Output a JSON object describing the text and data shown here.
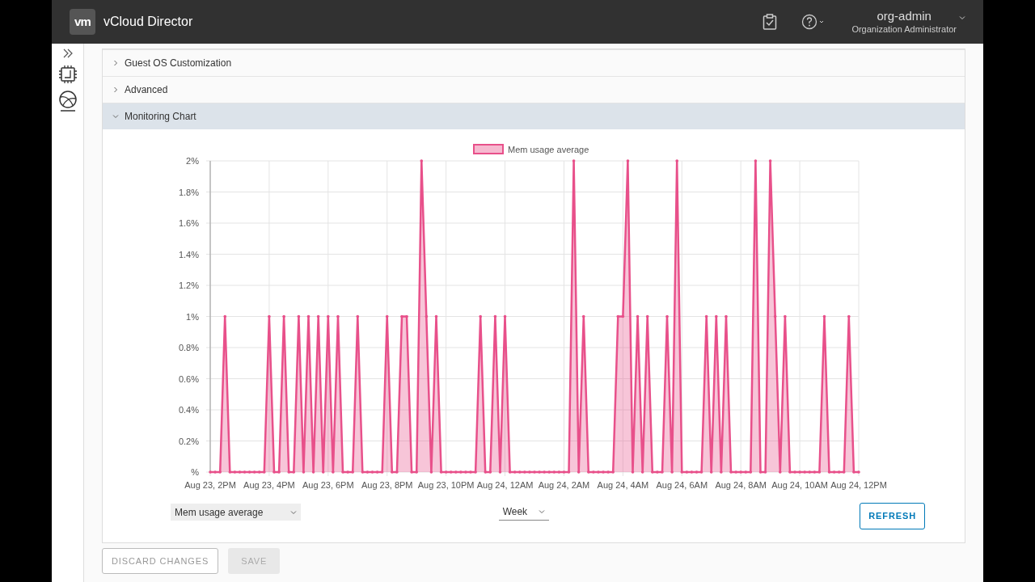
{
  "header": {
    "logo": "vm",
    "title": "vCloud Director",
    "user": "org-admin",
    "role": "Organization Administrator"
  },
  "sections": [
    {
      "label": "Guest OS Customization",
      "expanded": false
    },
    {
      "label": "Advanced",
      "expanded": false
    },
    {
      "label": "Monitoring Chart",
      "expanded": true
    }
  ],
  "monitoring": {
    "chart_data": {
      "type": "area",
      "categories": [
        "Aug 23, 2PM",
        null,
        null,
        null,
        null,
        null,
        null,
        null,
        null,
        null,
        null,
        null,
        "Aug 23, 4PM",
        null,
        null,
        null,
        null,
        null,
        null,
        null,
        null,
        null,
        null,
        null,
        "Aug 23, 6PM",
        null,
        null,
        null,
        null,
        null,
        null,
        null,
        null,
        null,
        null,
        null,
        "Aug 23, 8PM",
        null,
        null,
        null,
        null,
        null,
        null,
        null,
        null,
        null,
        null,
        null,
        "Aug 23, 10PM",
        null,
        null,
        null,
        null,
        null,
        null,
        null,
        null,
        null,
        null,
        null,
        "Aug 24, 12AM",
        null,
        null,
        null,
        null,
        null,
        null,
        null,
        null,
        null,
        null,
        null,
        "Aug 24, 2AM",
        null,
        null,
        null,
        null,
        null,
        null,
        null,
        null,
        null,
        null,
        null,
        "Aug 24, 4AM",
        null,
        null,
        null,
        null,
        null,
        null,
        null,
        null,
        null,
        null,
        null,
        "Aug 24, 6AM",
        null,
        null,
        null,
        null,
        null,
        null,
        null,
        null,
        null,
        null,
        null,
        "Aug 24, 8AM",
        null,
        null,
        null,
        null,
        null,
        null,
        null,
        null,
        null,
        null,
        null,
        "Aug 24, 10AM",
        null,
        null,
        null,
        null,
        null,
        null,
        null,
        null,
        null,
        null,
        null,
        "Aug 24, 12PM"
      ],
      "series": [
        {
          "name": "Mem usage average",
          "color": "#e8508a",
          "values": [
            0,
            0,
            0,
            1,
            0,
            0,
            0,
            0,
            0,
            0,
            0,
            0,
            1,
            0,
            0,
            1,
            0,
            0,
            1,
            0,
            1,
            0,
            1,
            0,
            1,
            0,
            1,
            0,
            0,
            0,
            1,
            0,
            0,
            0,
            0,
            0,
            1,
            0,
            0,
            1,
            1,
            0,
            0,
            2,
            1,
            0,
            1,
            0,
            0,
            0,
            0,
            0,
            0,
            0,
            0,
            1,
            0,
            0,
            1,
            0,
            1,
            0,
            0,
            0,
            0,
            0,
            0,
            0,
            0,
            0,
            0,
            0,
            0,
            0,
            2,
            0,
            1,
            0,
            0,
            0,
            0,
            0,
            0,
            1,
            1,
            2,
            0,
            1,
            0,
            1,
            0,
            0,
            0,
            1,
            0,
            2,
            0,
            0,
            0,
            0,
            0,
            1,
            0,
            1,
            0,
            1,
            0,
            0,
            0,
            0,
            0,
            2,
            0,
            0,
            2,
            1,
            0,
            1,
            0,
            0,
            0,
            0,
            0,
            0,
            0,
            1,
            0,
            0,
            0,
            0,
            1,
            0,
            0
          ]
        }
      ],
      "ylim": [
        0,
        2
      ],
      "grid": true,
      "yticks": [
        {
          "value": 0,
          "label": "%"
        },
        {
          "value": 0.2,
          "label": "0.2%"
        },
        {
          "value": 0.4,
          "label": "0.4%"
        },
        {
          "value": 0.6,
          "label": "0.6%"
        },
        {
          "value": 0.8,
          "label": "0.8%"
        },
        {
          "value": 1,
          "label": "1%"
        },
        {
          "value": 1.2,
          "label": "1.2%"
        },
        {
          "value": 1.4,
          "label": "1.4%"
        },
        {
          "value": 1.6,
          "label": "1.6%"
        },
        {
          "value": 1.8,
          "label": "1.8%"
        },
        {
          "value": 2,
          "label": "2%"
        }
      ]
    },
    "metric": "Mem usage average",
    "range": "Week",
    "refresh": "REFRESH"
  },
  "footer": {
    "buttons": [
      {
        "label": "DISCARD CHANGES",
        "disabled": false
      },
      {
        "label": "SAVE",
        "disabled": true
      }
    ]
  }
}
